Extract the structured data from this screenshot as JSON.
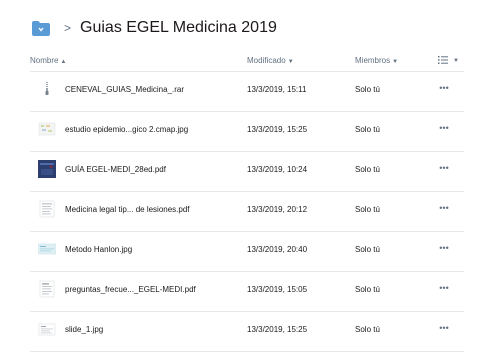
{
  "breadcrumb": {
    "folder_icon": "folder-icon",
    "separator": ">",
    "title": "Guias EGEL Medicina 2019",
    "folder_color": "#5b9bd5"
  },
  "table": {
    "columns": {
      "name": "Nombre",
      "name_sort": "▲",
      "modified": "Modificado",
      "modified_sort": "▼",
      "members": "Miembros",
      "members_sort": "▼",
      "view_icon": "list-view-icon",
      "view_caret": "▼"
    },
    "rows": [
      {
        "thumb": "zip-file-icon",
        "name": "CENEVAL_GUIAS_Medicina_.rar",
        "modified": "13/3/2019, 15:11",
        "members": "Solo tú",
        "more": "•••"
      },
      {
        "thumb": "image-thumbnail-icon",
        "name": "estudio epidemio...gico 2.cmap.jpg",
        "modified": "13/3/2019, 15:25",
        "members": "Solo tú",
        "more": "•••"
      },
      {
        "thumb": "pdf-cover-thumbnail",
        "name": "GUÍA EGEL-MEDI_28ed.pdf",
        "modified": "13/3/2019, 10:24",
        "members": "Solo tú",
        "more": "•••"
      },
      {
        "thumb": "document-thumbnail-icon",
        "name": "Medicina legal tip... de lesiones.pdf",
        "modified": "13/3/2019, 20:12",
        "members": "Solo tú",
        "more": "•••"
      },
      {
        "thumb": "image-thumbnail-icon",
        "name": "Metodo Hanlon.jpg",
        "modified": "13/3/2019, 20:40",
        "members": "Solo tú",
        "more": "•••"
      },
      {
        "thumb": "document-thumbnail-icon",
        "name": "preguntas_frecue..._EGEL-MEDI.pdf",
        "modified": "13/3/2019, 15:05",
        "members": "Solo tú",
        "more": "•••"
      },
      {
        "thumb": "image-thumbnail-icon",
        "name": "slide_1.jpg",
        "modified": "13/3/2019, 15:25",
        "members": "Solo tú",
        "more": "•••"
      }
    ]
  }
}
